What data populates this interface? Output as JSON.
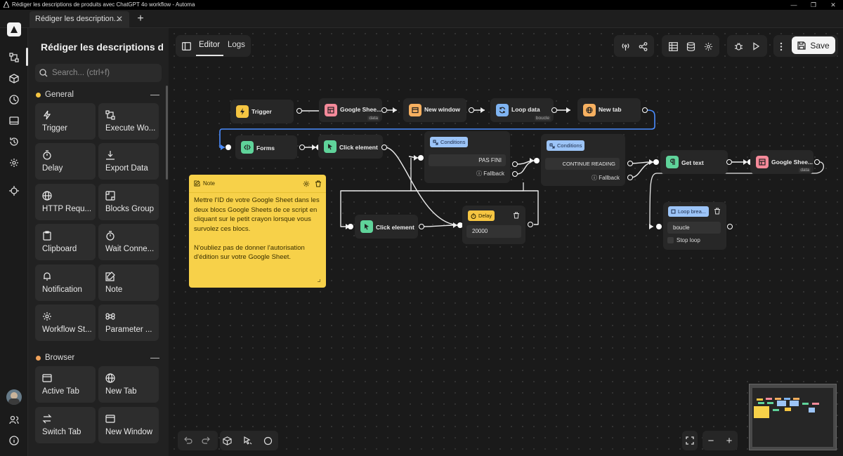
{
  "window": {
    "title": "Rédiger les descriptions de produits avec ChatGPT 4o workflow - Automa",
    "controls": [
      "—",
      "❐",
      "✕"
    ]
  },
  "tabs": [
    {
      "label": "Rédiger les description..."
    }
  ],
  "sidebar": {
    "workflow_title": "Rédiger les descriptions de...",
    "search_placeholder": "Search... (ctrl+f)",
    "categories": [
      {
        "name": "General",
        "color": "#f5c542"
      },
      {
        "name": "Browser",
        "color": "#f0a25a"
      }
    ],
    "blocks": [
      {
        "label": "Trigger",
        "icon": "bolt-icon"
      },
      {
        "label": "Execute Wo...",
        "icon": "execute-workflow-icon"
      },
      {
        "label": "Delay",
        "icon": "timer-icon"
      },
      {
        "label": "Export Data",
        "icon": "download-icon"
      },
      {
        "label": "HTTP Requ...",
        "icon": "globe-icon"
      },
      {
        "label": "Blocks Group",
        "icon": "blocks-group-icon"
      },
      {
        "label": "Clipboard",
        "icon": "clipboard-icon"
      },
      {
        "label": "Wait Conne...",
        "icon": "timer-icon"
      },
      {
        "label": "Notification",
        "icon": "bell-icon"
      },
      {
        "label": "Note",
        "icon": "note-icon"
      },
      {
        "label": "Workflow St...",
        "icon": "gear-icon"
      },
      {
        "label": "Parameter ...",
        "icon": "command-icon"
      },
      {
        "label": "Active Tab",
        "icon": "window-icon"
      },
      {
        "label": "New Tab",
        "icon": "globe-icon"
      },
      {
        "label": "Switch Tab",
        "icon": "switch-icon"
      },
      {
        "label": "New Window",
        "icon": "window-icon"
      }
    ]
  },
  "editor": {
    "tabs": [
      "Editor",
      "Logs"
    ],
    "save_label": "Save"
  },
  "nodes": {
    "trigger": {
      "label": "Trigger"
    },
    "sheets1": {
      "label": "Google Shee...",
      "sub": "data"
    },
    "new_window": {
      "label": "New window"
    },
    "loop_data": {
      "label": "Loop data",
      "sub": "boucle"
    },
    "new_tab": {
      "label": "New tab"
    },
    "forms": {
      "label": "Forms"
    },
    "click1": {
      "label": "Click element"
    },
    "cond1": {
      "badge": "Conditions",
      "path": "PAS FINI",
      "fallback": "Fallback"
    },
    "cond2": {
      "badge": "Conditions",
      "path": "CONTINUE READING",
      "fallback": "Fallback"
    },
    "get_text": {
      "label": "Get text"
    },
    "sheets2": {
      "label": "Google Shee...",
      "sub": "data"
    },
    "click2": {
      "label": "Click element"
    },
    "delay": {
      "badge": "Delay",
      "value": "20000"
    },
    "loop_break": {
      "badge": "Loop brea...",
      "value": "boucle",
      "stop": "Stop loop"
    }
  },
  "note": {
    "title": "Note",
    "text": "Mettre l'ID de votre Google Sheet dans les deux blocs Google Sheets de ce script en cliquant sur le petit crayon lorsque vous survolez ces blocs.\n\nN'oubliez pas de donner l'autorisation d'édition sur votre Google Sheet."
  }
}
